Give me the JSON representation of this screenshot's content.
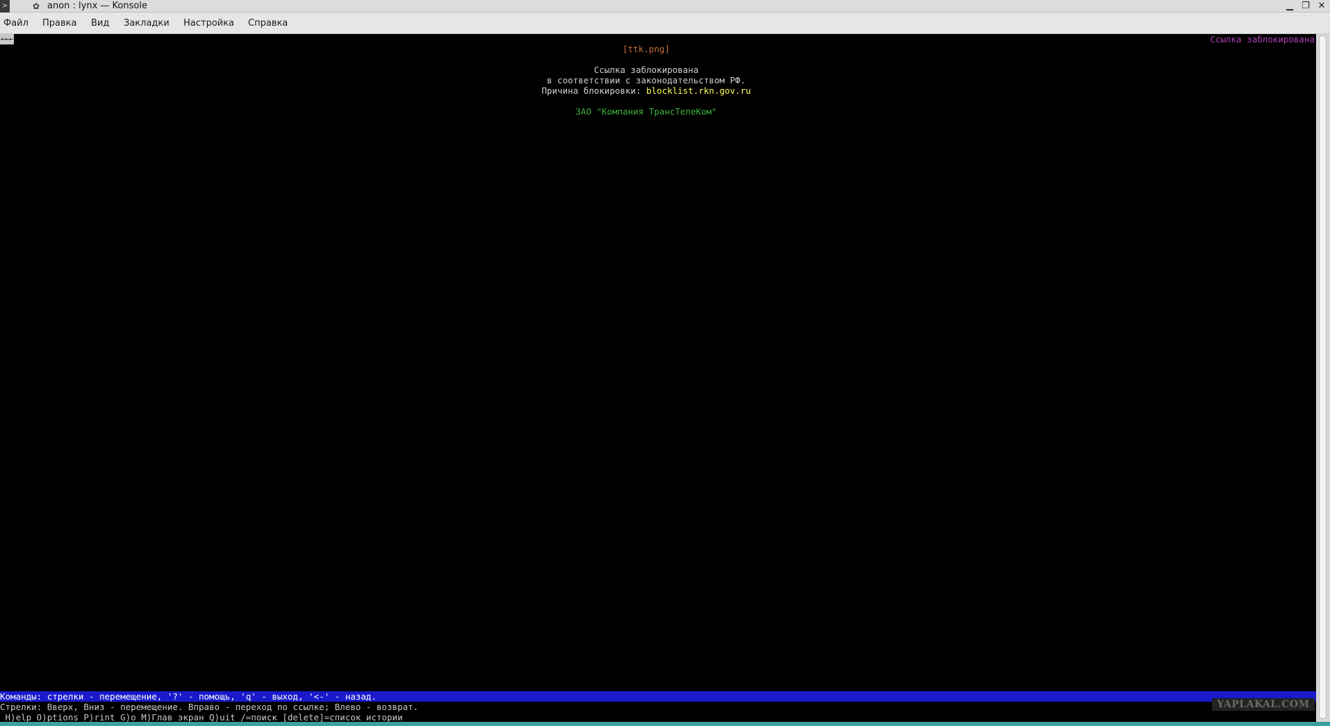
{
  "window": {
    "title": "anon : lynx — Konsole",
    "app_icon": ">",
    "pin_icon": "✿",
    "minimize_glyph": "▁",
    "maximize_glyph": "❐",
    "close_glyph": "✕"
  },
  "menubar": {
    "items": [
      {
        "label": "Файл"
      },
      {
        "label": "Правка"
      },
      {
        "label": "Вид"
      },
      {
        "label": "Закладки"
      },
      {
        "label": "Настройка"
      },
      {
        "label": "Справка"
      }
    ]
  },
  "terminal": {
    "back_arrows": "←←←",
    "status_right": "Ссылка заблокирована",
    "image_link": "[ttk.png]",
    "heading": "Ссылка заблокирована",
    "law_line": "в соответствии с законодательством РФ.",
    "reason_label": "Причина блокировки: ",
    "reason_link": "blocklist.rkn.gov.ru",
    "company": "ЗАО \"Компания ТрансТелеКом\"",
    "command_bar": "Команды: стрелки - перемещение, '?' - помощь, 'q' - выход, '<-' - назад.",
    "hint_line": "Стрелки: Вверх, Вниз - перемещение. Вправо - переход по ссылке; Влево - возврат.",
    "keys_line": " H)elp O)ptions P)rint G)o M)Глав экран Q)uit /=поиск [delete]=список истории",
    "watermark": "YAPLAKAL.COM"
  },
  "colors": {
    "terminal_bg": "#000000",
    "command_bar_bg": "#1a1acc",
    "link_yellow": "#ffff55",
    "company_green": "#3cb43c",
    "image_link_orange": "#c87038",
    "status_magenta": "#b040b0"
  }
}
